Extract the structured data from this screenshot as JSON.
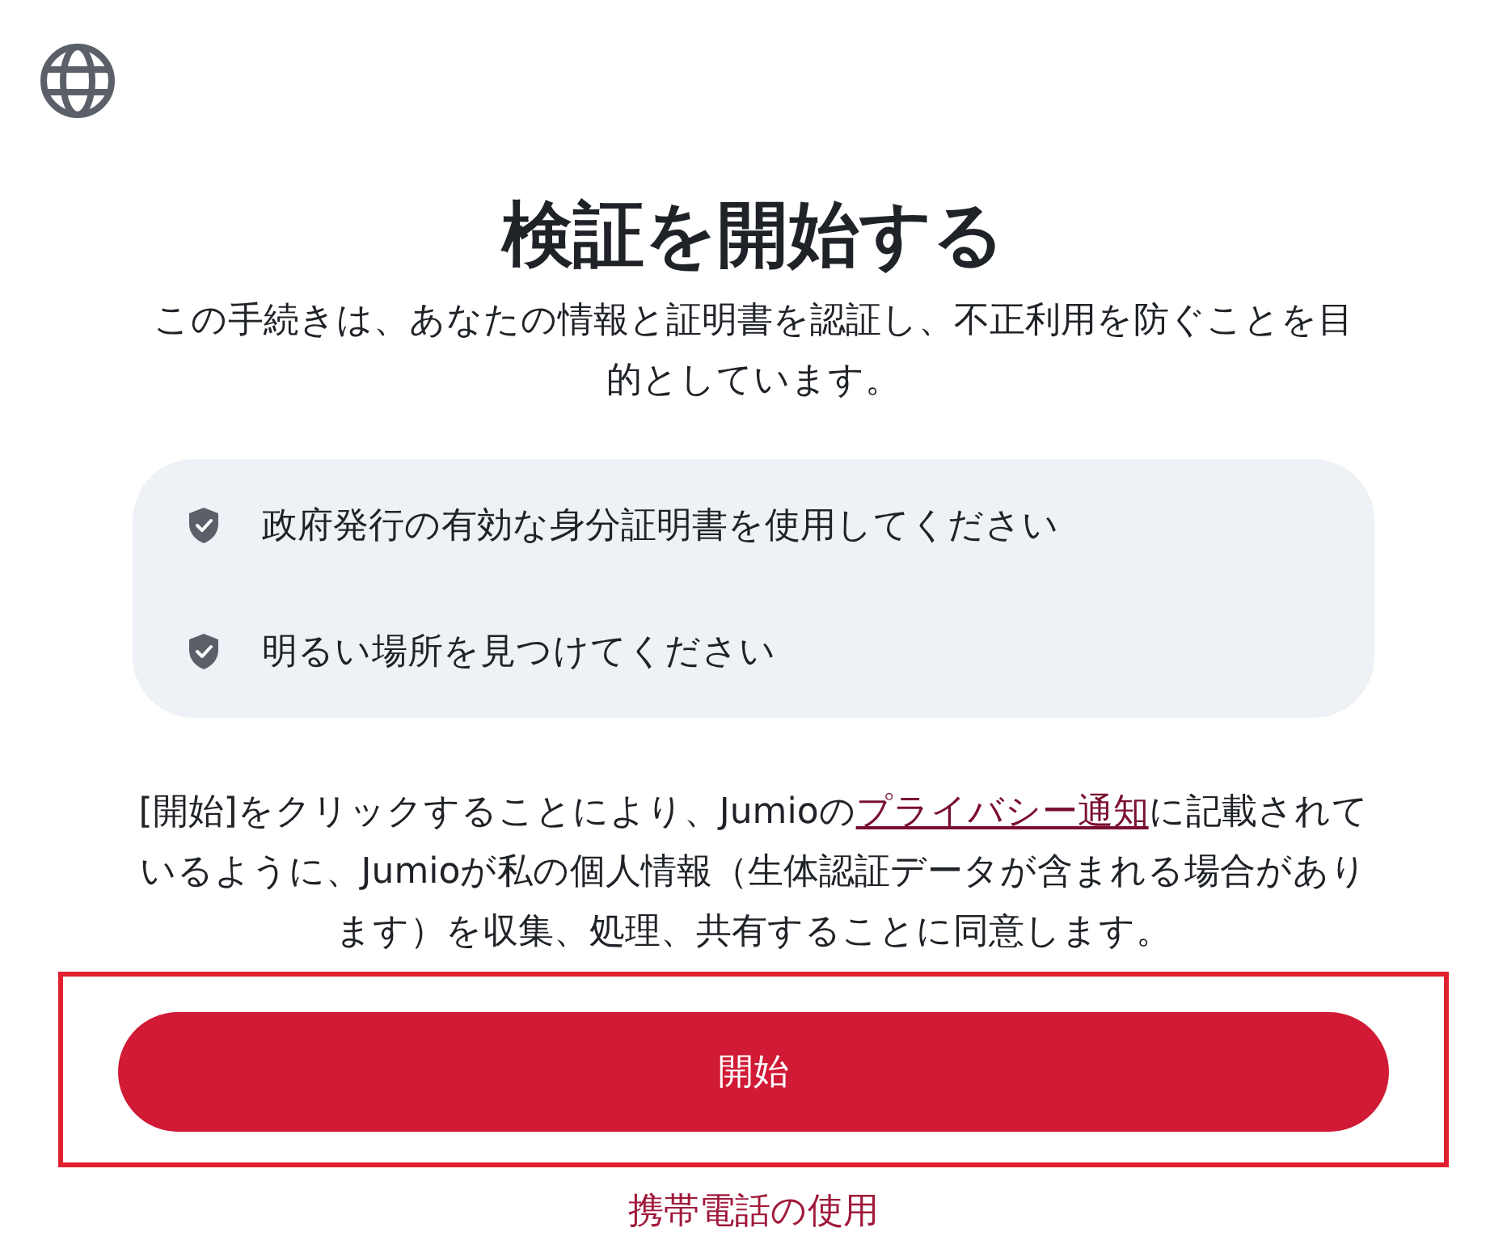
{
  "title": "検証を開始する",
  "description": "この手続きは、あなたの情報と証明書を認証し、不正利用を防ぐことを目的としています。",
  "checklist": [
    {
      "text": "政府発行の有効な身分証明書を使用してください"
    },
    {
      "text": "明るい場所を見つけてください"
    }
  ],
  "consent": {
    "before": "[開始]をクリックすることにより、Jumioの",
    "link": "プライバシー通知",
    "after": "に記載されているように、Jumioが私の個人情報（生体認証データが含まれる場合があります）を収集、処理、共有することに同意します。"
  },
  "start_button": {
    "label": "開始",
    "highlighted": true
  },
  "mobile_link": "携帯電話の使用"
}
